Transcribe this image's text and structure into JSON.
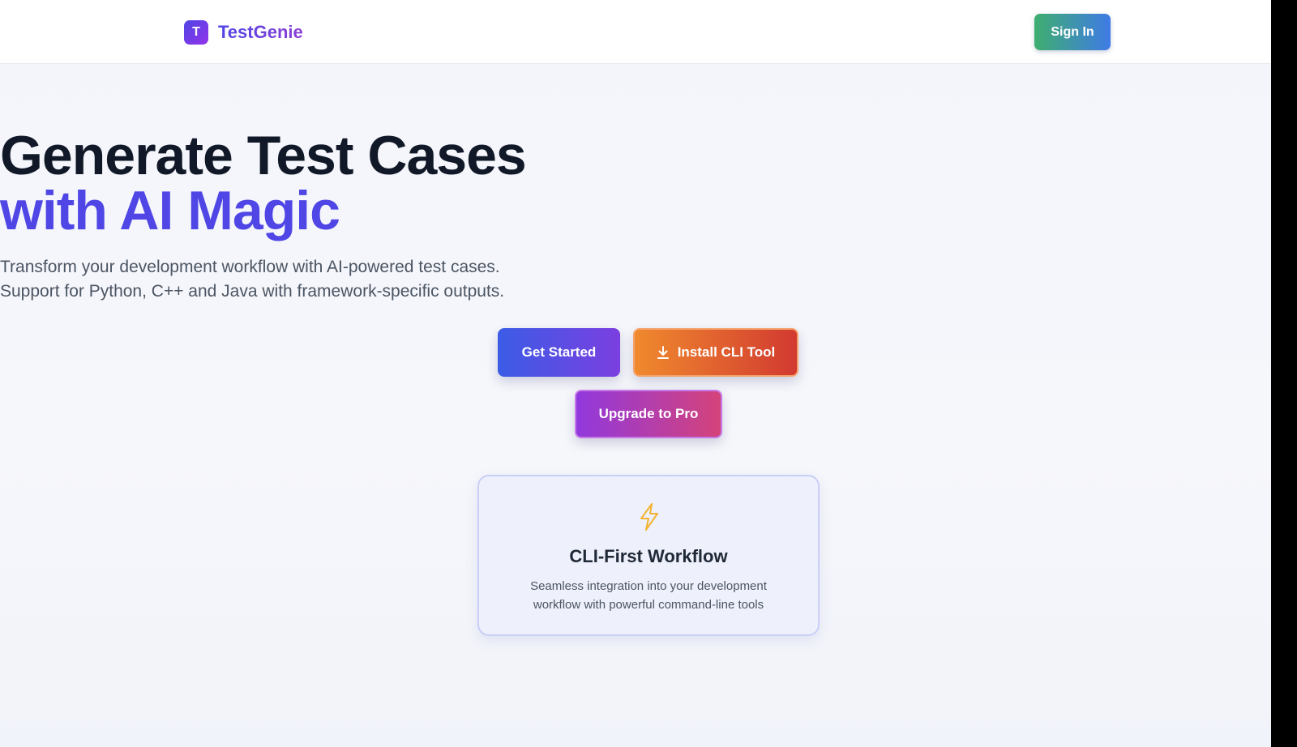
{
  "brand": {
    "logo_letter": "T",
    "name": "TestGenie"
  },
  "nav": {
    "signin_label": "Sign In"
  },
  "hero": {
    "title_line1": "Generate Test Cases",
    "title_line2": "with AI Magic",
    "subtitle_line1": "Transform your development workflow with AI-powered test cases.",
    "subtitle_line2": "Support for Python, C++ and Java with framework-specific outputs."
  },
  "actions": {
    "get_started": "Get Started",
    "install_cli": "Install CLI Tool",
    "upgrade": "Upgrade to Pro"
  },
  "feature": {
    "icon": "lightning-icon",
    "title": "CLI-First Workflow",
    "desc_line1": "Seamless integration into your development",
    "desc_line2": "workflow with powerful command-line tools"
  },
  "colors": {
    "brand_primary": "#4f46e5",
    "brand_secondary": "#9333ea",
    "signin_gradient": [
      "#3fae6f",
      "#3f7be6"
    ],
    "cli_gradient": [
      "#f08a2e",
      "#d23a30"
    ],
    "pro_gradient": [
      "#9138dd",
      "#d4437a"
    ],
    "lightning": "#f2b330"
  }
}
